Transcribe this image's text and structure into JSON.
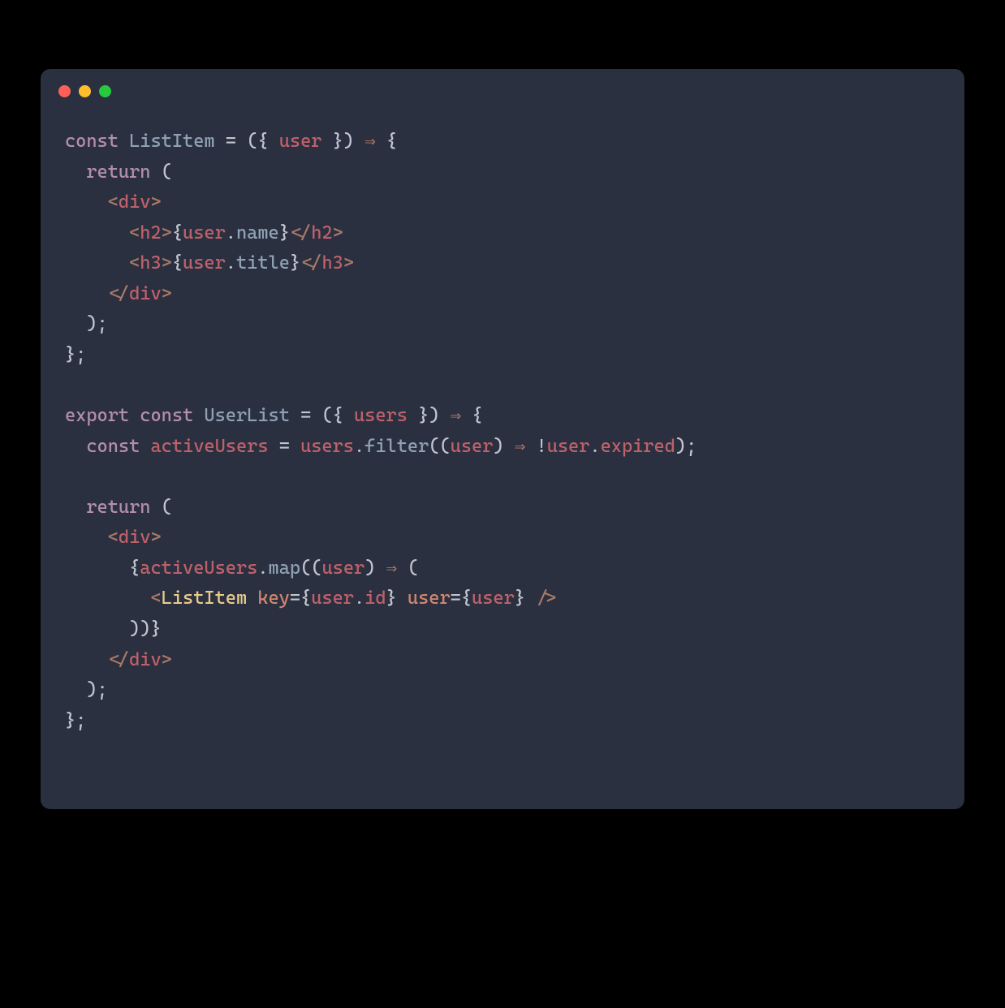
{
  "code": {
    "tokens": [
      [
        {
          "t": "const ",
          "c": "kw"
        },
        {
          "t": "ListItem ",
          "c": "fn"
        },
        {
          "t": "= ",
          "c": "op"
        },
        {
          "t": "({ ",
          "c": "punc"
        },
        {
          "t": "user ",
          "c": "var"
        },
        {
          "t": "}) ",
          "c": "punc"
        },
        {
          "t": "⇒",
          "c": "arrow"
        },
        {
          "t": " {",
          "c": "punc"
        }
      ],
      [
        {
          "t": "  ",
          "c": "plain"
        },
        {
          "t": "return ",
          "c": "kw"
        },
        {
          "t": "(",
          "c": "punc"
        }
      ],
      [
        {
          "t": "    ",
          "c": "plain"
        },
        {
          "t": "<",
          "c": "tag"
        },
        {
          "t": "div",
          "c": "tagname"
        },
        {
          "t": ">",
          "c": "tag"
        }
      ],
      [
        {
          "t": "      ",
          "c": "plain"
        },
        {
          "t": "<",
          "c": "tag"
        },
        {
          "t": "h2",
          "c": "tagname"
        },
        {
          "t": ">",
          "c": "tag"
        },
        {
          "t": "{",
          "c": "punc"
        },
        {
          "t": "user",
          "c": "var"
        },
        {
          "t": ".",
          "c": "punc"
        },
        {
          "t": "name",
          "c": "prop"
        },
        {
          "t": "}",
          "c": "punc"
        },
        {
          "t": "</",
          "c": "tag"
        },
        {
          "t": "h2",
          "c": "tagname"
        },
        {
          "t": ">",
          "c": "tag"
        }
      ],
      [
        {
          "t": "      ",
          "c": "plain"
        },
        {
          "t": "<",
          "c": "tag"
        },
        {
          "t": "h3",
          "c": "tagname"
        },
        {
          "t": ">",
          "c": "tag"
        },
        {
          "t": "{",
          "c": "punc"
        },
        {
          "t": "user",
          "c": "var"
        },
        {
          "t": ".",
          "c": "punc"
        },
        {
          "t": "title",
          "c": "prop"
        },
        {
          "t": "}",
          "c": "punc"
        },
        {
          "t": "</",
          "c": "tag"
        },
        {
          "t": "h3",
          "c": "tagname"
        },
        {
          "t": ">",
          "c": "tag"
        }
      ],
      [
        {
          "t": "    ",
          "c": "plain"
        },
        {
          "t": "</",
          "c": "tag"
        },
        {
          "t": "div",
          "c": "tagname"
        },
        {
          "t": ">",
          "c": "tag"
        }
      ],
      [
        {
          "t": "  );",
          "c": "punc"
        }
      ],
      [
        {
          "t": "};",
          "c": "punc"
        }
      ],
      [
        {
          "t": "",
          "c": "plain"
        }
      ],
      [
        {
          "t": "export ",
          "c": "kw"
        },
        {
          "t": "const ",
          "c": "kw"
        },
        {
          "t": "UserList ",
          "c": "fn"
        },
        {
          "t": "= ",
          "c": "op"
        },
        {
          "t": "({ ",
          "c": "punc"
        },
        {
          "t": "users ",
          "c": "var"
        },
        {
          "t": "}) ",
          "c": "punc"
        },
        {
          "t": "⇒",
          "c": "arrow"
        },
        {
          "t": " {",
          "c": "punc"
        }
      ],
      [
        {
          "t": "  ",
          "c": "plain"
        },
        {
          "t": "const ",
          "c": "kw"
        },
        {
          "t": "activeUsers ",
          "c": "var"
        },
        {
          "t": "= ",
          "c": "op"
        },
        {
          "t": "users",
          "c": "var"
        },
        {
          "t": ".",
          "c": "punc"
        },
        {
          "t": "filter",
          "c": "fn"
        },
        {
          "t": "((",
          "c": "punc"
        },
        {
          "t": "user",
          "c": "var"
        },
        {
          "t": ") ",
          "c": "punc"
        },
        {
          "t": "⇒",
          "c": "arrow"
        },
        {
          "t": " !",
          "c": "op"
        },
        {
          "t": "user",
          "c": "var"
        },
        {
          "t": ".",
          "c": "punc"
        },
        {
          "t": "expired",
          "c": "var"
        },
        {
          "t": ");",
          "c": "punc"
        }
      ],
      [
        {
          "t": "",
          "c": "plain"
        }
      ],
      [
        {
          "t": "  ",
          "c": "plain"
        },
        {
          "t": "return ",
          "c": "kw"
        },
        {
          "t": "(",
          "c": "punc"
        }
      ],
      [
        {
          "t": "    ",
          "c": "plain"
        },
        {
          "t": "<",
          "c": "tag"
        },
        {
          "t": "div",
          "c": "tagname"
        },
        {
          "t": ">",
          "c": "tag"
        }
      ],
      [
        {
          "t": "      ",
          "c": "plain"
        },
        {
          "t": "{",
          "c": "punc"
        },
        {
          "t": "activeUsers",
          "c": "var"
        },
        {
          "t": ".",
          "c": "punc"
        },
        {
          "t": "map",
          "c": "fn"
        },
        {
          "t": "((",
          "c": "punc"
        },
        {
          "t": "user",
          "c": "var"
        },
        {
          "t": ") ",
          "c": "punc"
        },
        {
          "t": "⇒",
          "c": "arrow"
        },
        {
          "t": " (",
          "c": "punc"
        }
      ],
      [
        {
          "t": "        ",
          "c": "plain"
        },
        {
          "t": "<",
          "c": "tag"
        },
        {
          "t": "ListItem ",
          "c": "comp"
        },
        {
          "t": "key",
          "c": "attr"
        },
        {
          "t": "={",
          "c": "punc"
        },
        {
          "t": "user",
          "c": "var"
        },
        {
          "t": ".",
          "c": "punc"
        },
        {
          "t": "id",
          "c": "var"
        },
        {
          "t": "} ",
          "c": "punc"
        },
        {
          "t": "user",
          "c": "attr"
        },
        {
          "t": "={",
          "c": "punc"
        },
        {
          "t": "user",
          "c": "var"
        },
        {
          "t": "} ",
          "c": "punc"
        },
        {
          "t": "/>",
          "c": "tag"
        }
      ],
      [
        {
          "t": "      ",
          "c": "plain"
        },
        {
          "t": "))}",
          "c": "punc"
        }
      ],
      [
        {
          "t": "    ",
          "c": "plain"
        },
        {
          "t": "</",
          "c": "tag"
        },
        {
          "t": "div",
          "c": "tagname"
        },
        {
          "t": ">",
          "c": "tag"
        }
      ],
      [
        {
          "t": "  );",
          "c": "punc"
        }
      ],
      [
        {
          "t": "};",
          "c": "punc"
        }
      ]
    ]
  },
  "colors": {
    "background": "#2a3040",
    "red": "#ff5f56",
    "yellow": "#ffbd2e",
    "green": "#27c93f"
  }
}
